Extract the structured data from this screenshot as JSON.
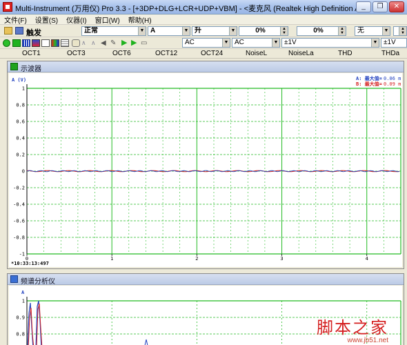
{
  "window": {
    "title": "Multi-Instrument (万用仪) Pro 3.3   -  [+3DP+DLG+LCR+UDP+VBM]  -  <麦克风 (Realtek High Definition Au>",
    "buttons": [
      "minimize",
      "restore",
      "close"
    ]
  },
  "menu": [
    "文件(F)",
    "设置(S)",
    "仪器(I)",
    "窗口(W)",
    "帮助(H)"
  ],
  "toolbar1": {
    "trigger_label": "触发",
    "mode_value": "正常",
    "channel_value": "A",
    "edge_value": "升",
    "percent1_value": "0%",
    "percent2_value": "0%",
    "last_value": "无"
  },
  "toolbar2": {
    "coupling_a": "AC",
    "coupling_b": "AC",
    "range_a": "±1V",
    "range_b": "±1V"
  },
  "bands": [
    "OCT1",
    "OCT3",
    "OCT6",
    "OCT12",
    "OCT24",
    "NoiseL",
    "NoiseLa",
    "THD",
    "THDa"
  ],
  "oscilloscope": {
    "title": "示波器",
    "y_axis_label": "A (V)",
    "readout_a_label": "A: 最大值=",
    "readout_a_value": "0.06 m",
    "readout_b_label": "B: 最大值=",
    "readout_b_value": "0.09 m",
    "timestamp": "*10:33:13:497",
    "y_ticks": [
      "1",
      "0.8",
      "0.6",
      "0.4",
      "0.2",
      "0",
      "-0.2",
      "-0.4",
      "-0.6",
      "-0.8",
      "-1"
    ],
    "x_ticks": [
      "0",
      "1",
      "2",
      "3",
      "4"
    ],
    "colors": {
      "channel_a": "#1f3fbf",
      "channel_b": "#d42020",
      "grid": "#22bb22"
    }
  },
  "spectrum": {
    "title": "频谱分析仪",
    "y_axis_label": "A",
    "y_ticks": [
      "1",
      "0.9",
      "0.8"
    ]
  },
  "watermark": {
    "text": "脚本之家",
    "url": "www.jb51.net"
  }
}
